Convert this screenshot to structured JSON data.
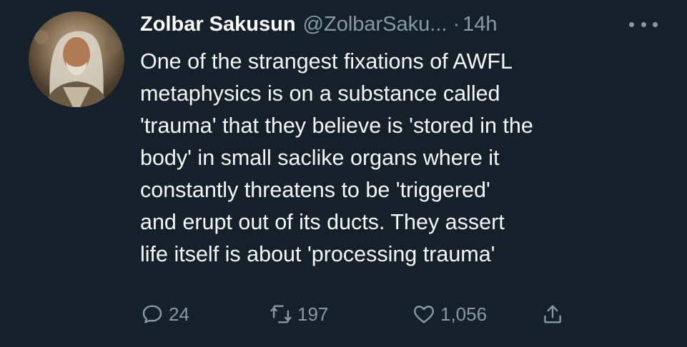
{
  "author": {
    "display_name": "Zolbar Sakusun",
    "handle": "@ZolbarSaku...",
    "separator": "·",
    "timestamp": "14h"
  },
  "tweet": {
    "lines": [
      "One of the strangest fixations of AWFL",
      "metaphysics is on a substance called",
      "'trauma' that they believe is 'stored in the",
      "body' in small saclike organs where it",
      "constantly threatens to be 'triggered'",
      "and erupt out of its ducts. They assert",
      "life itself is about 'processing trauma'"
    ]
  },
  "actions": {
    "reply_count": "24",
    "retweet_count": "197",
    "like_count": "1,056"
  },
  "icons": {
    "more": "more-dots-icon",
    "reply": "reply-icon",
    "retweet": "retweet-icon",
    "like": "heart-icon",
    "share": "share-icon"
  },
  "colors": {
    "background": "#15202b",
    "text": "#f5f8fa",
    "secondary": "#8899a6"
  }
}
